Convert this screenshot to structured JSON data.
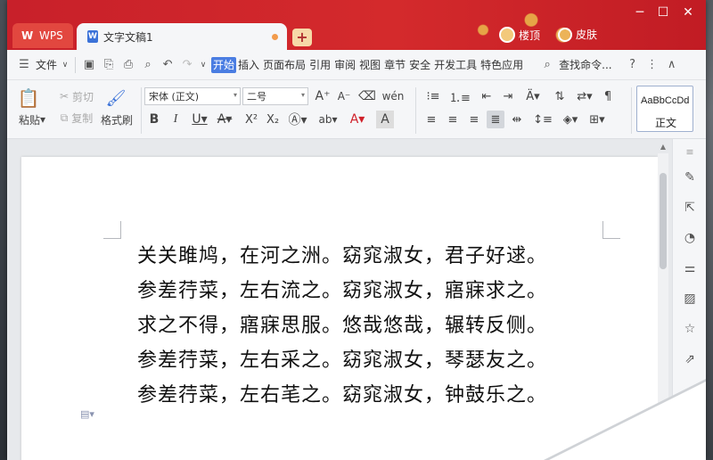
{
  "window": {
    "tabs": [
      {
        "label": "WPS"
      },
      {
        "label": "文字文稿1"
      }
    ],
    "user_label": "楼顶",
    "skin_label": "皮肤"
  },
  "menu": {
    "file_label": "文件",
    "items": [
      "开始",
      "插入",
      "页面布局",
      "引用",
      "审阅",
      "视图",
      "章节",
      "安全",
      "开发工具",
      "特色应用"
    ],
    "search_label": "查找命令..."
  },
  "ribbon": {
    "paste_label": "粘贴",
    "cut_label": "剪切",
    "copy_label": "复制",
    "format_painter_label": "格式刷",
    "font_name": "宋体 (正文)",
    "font_size": "二号",
    "style_preview": "AaBbCcDd",
    "style_name": "正文"
  },
  "document": {
    "lines": [
      "关关雎鸠，在河之洲。窈窕淑女，君子好逑。",
      "参差荇菜，左右流之。窈窕淑女，寤寐求之。",
      "求之不得，寤寐思服。悠哉悠哉，辗转反侧。",
      "参差荇菜，左右采之。窈窕淑女，琴瑟友之。",
      "参差荇菜，左右芼之。窈窕淑女，钟鼓乐之。"
    ]
  },
  "colors": {
    "titlebar": "#d42a2c",
    "accent": "#4a7de2"
  }
}
